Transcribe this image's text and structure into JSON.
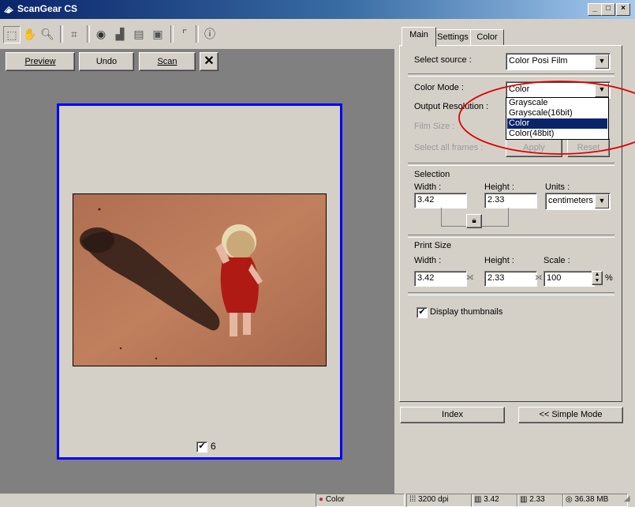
{
  "window": {
    "title": "ScanGear CS",
    "controls": [
      "_",
      "□",
      "×"
    ]
  },
  "toolbar": {
    "icons": [
      "select-marquee-icon",
      "hand-icon",
      "zoom-icon",
      "auto-crop-icon",
      "color-wheel-icon",
      "auto-tone-icon",
      "frames-icon",
      "rotate-icon",
      "ruler-icon",
      "info-icon"
    ]
  },
  "preview": {
    "buttons": {
      "preview": "Preview",
      "undo": "Undo",
      "scan": "Scan",
      "close": "✕"
    },
    "frame_number": "6",
    "frame_checked": true,
    "selection_color": "#0000ff"
  },
  "tabs": [
    {
      "label": "Main",
      "active": true
    },
    {
      "label": "Settings"
    },
    {
      "label": "Color"
    }
  ],
  "main": {
    "select_source_label": "Select source :",
    "select_source_value": "Color Posi Film",
    "color_mode_label": "Color Mode :",
    "color_mode_value": "Color",
    "color_mode_options": [
      "Grayscale",
      "Grayscale(16bit)",
      "Color",
      "Color(48bit)"
    ],
    "color_mode_selected": "Color",
    "output_resolution_label": "Output Resolution :",
    "film_size_label": "Film Size :",
    "select_all_frames_label": "Select all frames :",
    "apply_label": "Apply",
    "reset_label": "Reset",
    "selection_label": "Selection",
    "width_label": "Width :",
    "height_label": "Height :",
    "units_label": "Units :",
    "sel_width": "3.42",
    "sel_height": "2.33",
    "units_value": "centimeters",
    "print_size_label": "Print Size",
    "scale_label": "Scale :",
    "print_width": "3.42",
    "print_height": "2.33",
    "scale_value": "100",
    "percent": "%",
    "display_thumbnails_label": "Display thumbnails",
    "display_thumbnails_checked": true
  },
  "bottom": {
    "index_label": "Index",
    "simple_mode_label": "<< Simple Mode"
  },
  "status": {
    "color_mode": "Color",
    "resolution": "3200 dpi",
    "width": "3.42",
    "height": "2.33",
    "size": "36.38 MB"
  },
  "annotation": {
    "color": "#e00000"
  }
}
